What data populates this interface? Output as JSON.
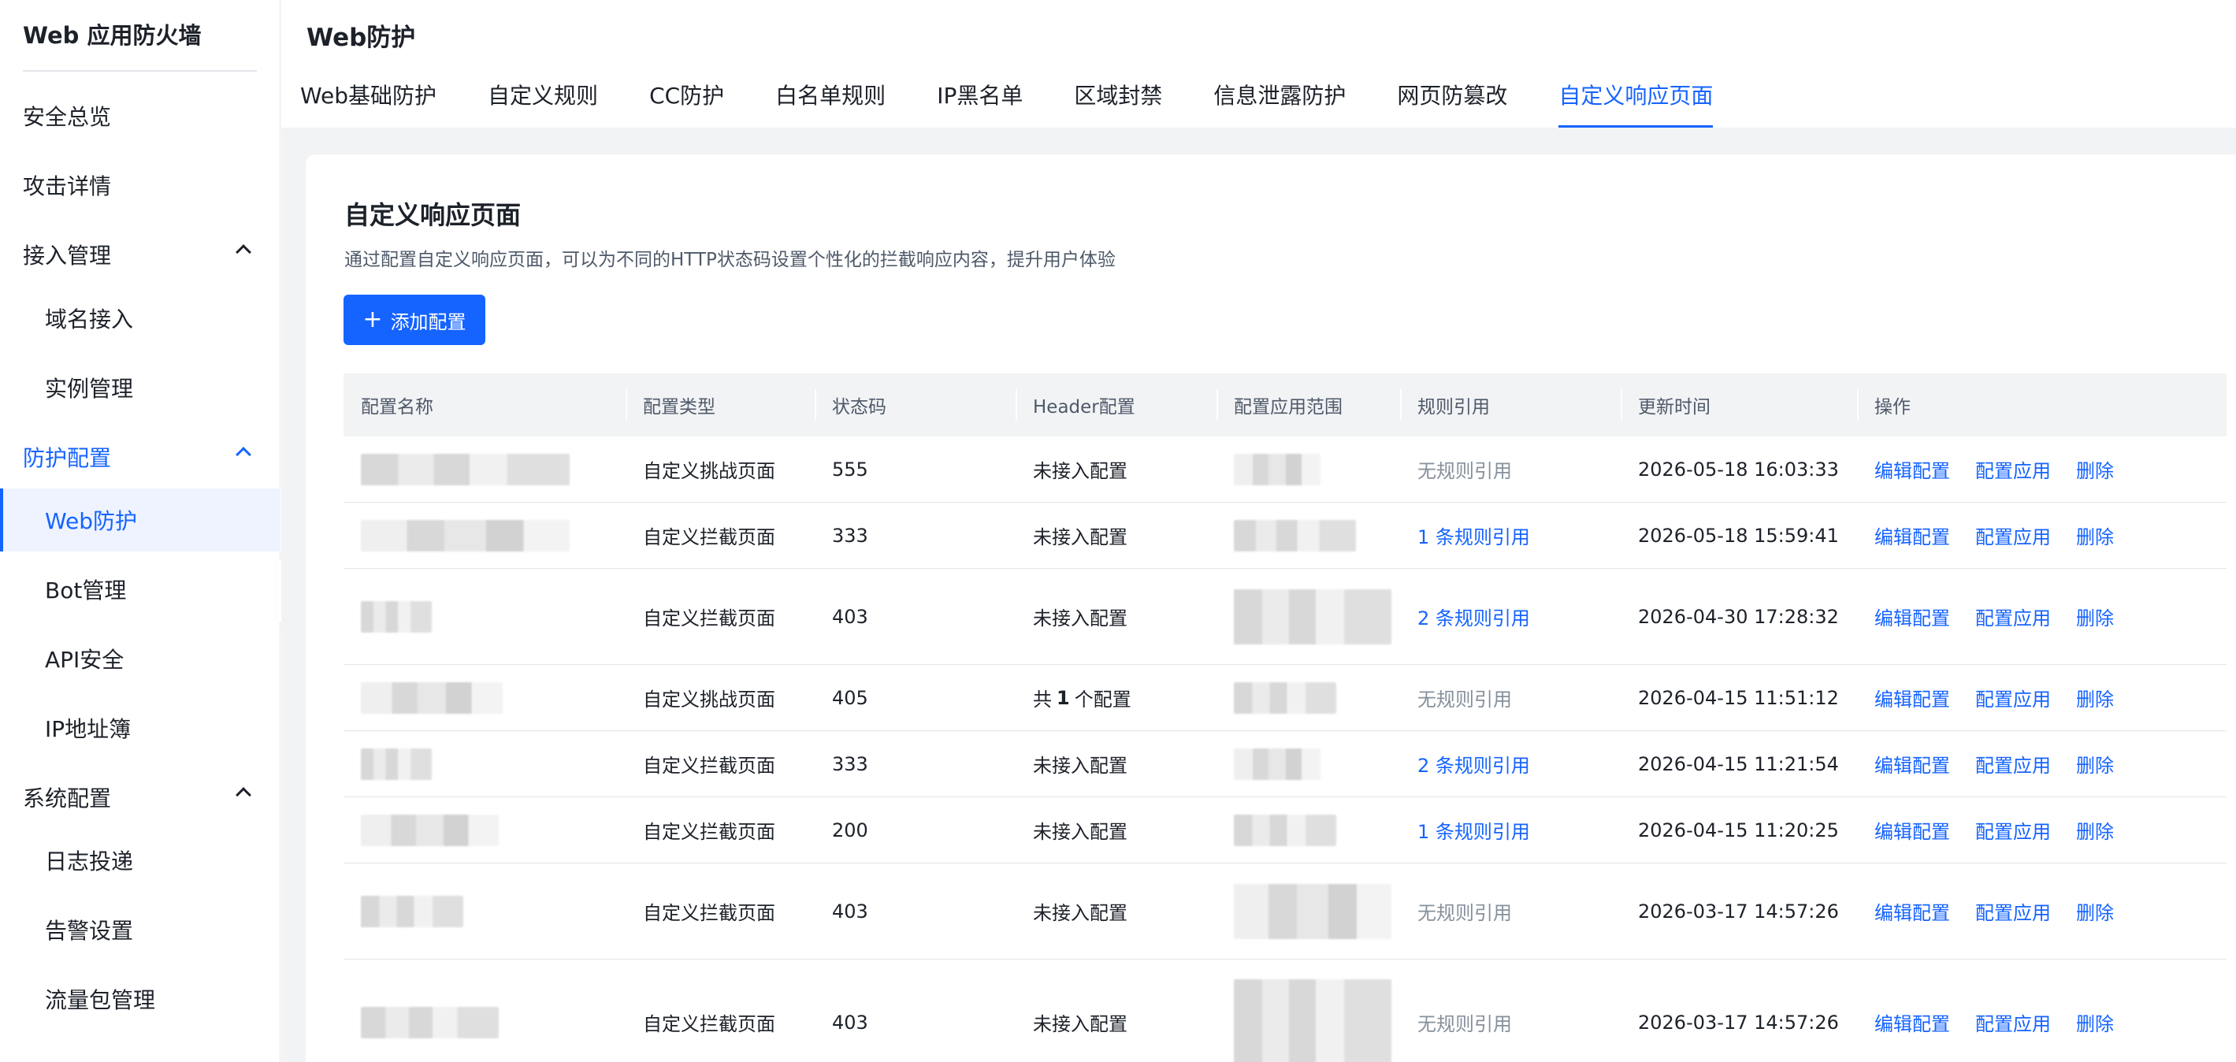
{
  "sidebar": {
    "title": "Web 应用防火墙",
    "items": [
      {
        "label": "安全总览"
      },
      {
        "label": "攻击详情"
      },
      {
        "label": "接入管理"
      },
      {
        "label": "域名接入"
      },
      {
        "label": "实例管理"
      },
      {
        "label": "防护配置"
      },
      {
        "label": "Web防护"
      },
      {
        "label": "Bot管理"
      },
      {
        "label": "API安全"
      },
      {
        "label": "IP地址簿"
      },
      {
        "label": "系统配置"
      },
      {
        "label": "日志投递"
      },
      {
        "label": "告警设置"
      },
      {
        "label": "流量包管理"
      }
    ]
  },
  "header": {
    "title": "Web防护",
    "tabs": [
      {
        "label": "Web基础防护"
      },
      {
        "label": "自定义规则"
      },
      {
        "label": "CC防护"
      },
      {
        "label": "白名单规则"
      },
      {
        "label": "IP黑名单"
      },
      {
        "label": "区域封禁"
      },
      {
        "label": "信息泄露防护"
      },
      {
        "label": "网页防篡改"
      },
      {
        "label": "自定义响应页面"
      }
    ]
  },
  "main": {
    "title": "自定义响应页面",
    "description": "通过配置自定义响应页面，可以为不同的HTTP状态码设置个性化的拦截响应内容，提升用户体验",
    "add_button": "添加配置",
    "columns": [
      "配置名称",
      "配置类型",
      "状态码",
      "Header配置",
      "配置应用范围",
      "规则引用",
      "更新时间",
      "操作"
    ],
    "rows": [
      {
        "type": "自定义挑战页面",
        "status": "555",
        "header": "未接入配置",
        "ref": "无规则引用",
        "updated": "2026-05-18 16:03:33"
      },
      {
        "type": "自定义拦截页面",
        "status": "333",
        "header": "未接入配置",
        "ref": "1 条规则引用",
        "updated": "2026-05-18 15:59:41"
      },
      {
        "type": "自定义拦截页面",
        "status": "403",
        "header": "未接入配置",
        "ref": "2 条规则引用",
        "updated": "2026-04-30 17:28:32"
      },
      {
        "type": "自定义挑战页面",
        "status": "405",
        "header_prefix": "共",
        "header_count": "1",
        "header_suffix": "个配置",
        "ref": "无规则引用",
        "updated": "2026-04-15 11:51:12"
      },
      {
        "type": "自定义拦截页面",
        "status": "333",
        "header": "未接入配置",
        "ref": "2 条规则引用",
        "updated": "2026-04-15 11:21:54"
      },
      {
        "type": "自定义拦截页面",
        "status": "200",
        "header": "未接入配置",
        "ref": "1 条规则引用",
        "updated": "2026-04-15 11:20:25"
      },
      {
        "type": "自定义拦截页面",
        "status": "403",
        "header": "未接入配置",
        "ref": "无规则引用",
        "updated": "2026-03-17 14:57:26"
      },
      {
        "type": "自定义拦截页面",
        "status": "403",
        "header": "未接入配置",
        "ref": "无规则引用",
        "updated": "2026-03-17 14:57:26"
      }
    ],
    "actions": {
      "edit": "编辑配置",
      "apply": "配置应用",
      "delete": "删除"
    }
  },
  "colors": {
    "accent": "#1664ff",
    "muted": "#86909c",
    "page_bg": "#f2f3f5"
  }
}
